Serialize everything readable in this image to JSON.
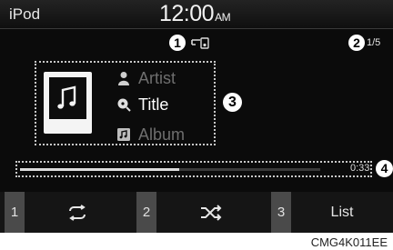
{
  "header": {
    "source": "iPod",
    "time": "12:00",
    "ampm": "AM"
  },
  "callouts": {
    "c1": "1",
    "c2": "2",
    "c3": "3",
    "c4": "4"
  },
  "track_count": "1/5",
  "now_playing": {
    "artist_label": "Artist",
    "title_label": "Title",
    "album_label": "Album",
    "elapsed": "0:33",
    "progress": 0.53
  },
  "softkeys": {
    "k1": "1",
    "k2": "2",
    "k3": "3",
    "list_label": "List",
    "repeat_icon": "repeat-icon",
    "shuffle_icon": "shuffle-icon"
  },
  "caption": "CMG4K011EE"
}
